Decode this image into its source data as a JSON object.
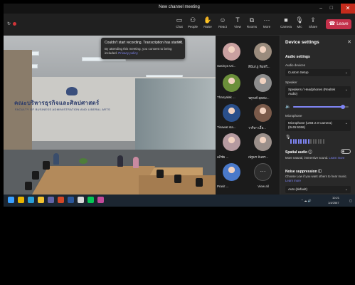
{
  "window": {
    "title": "New channel meeting",
    "minimize": "–",
    "maximize": "□",
    "close": "✕"
  },
  "toolbar": {
    "recording_time": "",
    "items": [
      {
        "label": "Chat",
        "icon": "chat-icon"
      },
      {
        "label": "People",
        "icon": "people-icon"
      },
      {
        "label": "Raise",
        "icon": "raise-hand-icon"
      },
      {
        "label": "React",
        "icon": "react-icon"
      },
      {
        "label": "View",
        "icon": "view-icon"
      },
      {
        "label": "Rooms",
        "icon": "rooms-icon"
      },
      {
        "label": "More",
        "icon": "more-icon"
      },
      {
        "label": "Camera",
        "icon": "camera-icon"
      },
      {
        "label": "Mic",
        "icon": "mic-icon"
      },
      {
        "label": "Share",
        "icon": "share-icon"
      }
    ],
    "leave_label": "Leave"
  },
  "toast": {
    "title": "Couldn't start recording. Transcription has started.",
    "body": "By attending this meeting, you consent to being included.",
    "link": "Privacy policy"
  },
  "room": {
    "sign_main": "คณะบริหารธุรกิจและศิลปศาสตร์",
    "sign_sub": "FACULTY OF BUSINESS ADMINISTRATION AND LIBERAL ARTS"
  },
  "participants": [
    {
      "name": "Sasinya Uti...",
      "color": "#c9a0a0"
    },
    {
      "name": "สินีนาฏ พิมพ์ใ...",
      "color": "#9a8b7d"
    },
    {
      "name": "Thanyalak ...",
      "color": "#6b8f3a"
    },
    {
      "name": "จตุรงค์ อุดสม...",
      "color": "#8d8d8d"
    },
    {
      "name": "Tinawat sta...",
      "color": "#2a4f8a"
    },
    {
      "name": "วาริษา เอื้อ...",
      "color": "#7a5a4a"
    },
    {
      "name": "อภิชัย ...",
      "color": "#b59aa0"
    },
    {
      "name": "ณัฐพร จันทร...",
      "color": "#9a8f8a"
    },
    {
      "name": "Prasit ...",
      "color": "#4a79c9"
    }
  ],
  "view_all": {
    "label": "View all",
    "icon": "ellipsis-icon"
  },
  "settings": {
    "title": "Device settings",
    "audio_settings": "Audio settings",
    "audio_devices_label": "Audio devices",
    "audio_devices_value": "Custom Setup",
    "speaker_label": "Speaker",
    "speaker_value": "Speakers / Headphones (Realtek Audio)",
    "speaker_volume": 0.9,
    "microphone_label": "Microphone",
    "microphone_value": "Microphone (USB 2.0 Camera) (0c45:6366)",
    "mic_level_bars": 14,
    "mic_level_active": 8,
    "spatial_label": "Spatial audio",
    "spatial_desc": "More natural, immersive sound.",
    "spatial_link": "Learn more",
    "noise_label": "Noise suppression",
    "noise_desc": "Choose Low if you want others to hear music.",
    "noise_link": "Learn more",
    "noise_value": "Auto (default)"
  },
  "taskbar": {
    "time": "10:21",
    "date": "1/4/2567",
    "apps": [
      {
        "icon": "windows-start-icon",
        "color": "#3aa0ff"
      },
      {
        "icon": "chrome-icon",
        "color": "#e8b400"
      },
      {
        "icon": "edge-icon",
        "color": "#2a9fd8"
      },
      {
        "icon": "file-explorer-icon",
        "color": "#f2c230"
      },
      {
        "icon": "teams-icon",
        "color": "#6264a7"
      },
      {
        "icon": "powerpoint-icon",
        "color": "#d24726"
      },
      {
        "icon": "word-icon",
        "color": "#2b579a"
      },
      {
        "icon": "settings-icon",
        "color": "#d8d8d8"
      },
      {
        "icon": "line-icon",
        "color": "#06c755"
      },
      {
        "icon": "photos-icon",
        "color": "#c34a9a"
      }
    ]
  }
}
